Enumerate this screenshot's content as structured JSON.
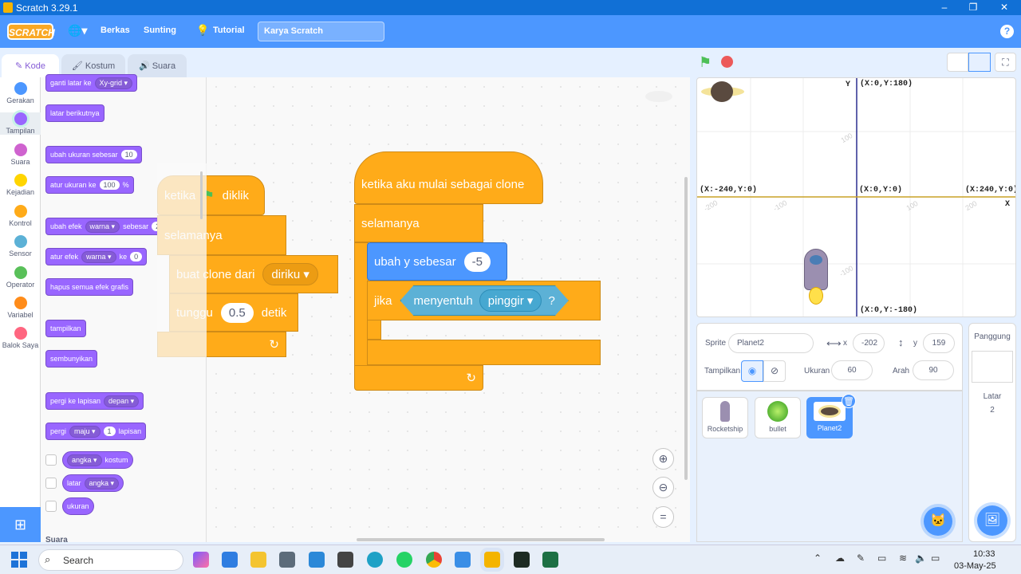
{
  "window": {
    "title": "Scratch 3.29.1",
    "minimize": "–",
    "maximize": "❐",
    "close": "✕"
  },
  "menubar": {
    "logo": "SCRATCH",
    "globe": "🌐▾",
    "file": "Berkas",
    "edit": "Sunting",
    "tutorial": "Tutorial",
    "project_title": "Karya Scratch",
    "help": "?"
  },
  "tabs": {
    "code": "Kode",
    "costume": "Kostum",
    "sound": "Suara"
  },
  "categories": [
    {
      "label": "Gerakan",
      "color": "#4c97ff"
    },
    {
      "label": "Tampilan",
      "color": "#9966ff"
    },
    {
      "label": "Suara",
      "color": "#cf63cf"
    },
    {
      "label": "Kejadian",
      "color": "#ffd500"
    },
    {
      "label": "Kontrol",
      "color": "#ffab19"
    },
    {
      "label": "Sensor",
      "color": "#5cb1d6"
    },
    {
      "label": "Operator",
      "color": "#59c059"
    },
    {
      "label": "Variabel",
      "color": "#ff8c1a"
    },
    {
      "label": "Balok Saya",
      "color": "#ff6680"
    }
  ],
  "palette": {
    "switch_backdrop": "ganti latar ke",
    "switch_backdrop_value": "Xy-grid ▾",
    "next_backdrop": "latar berikutnya",
    "change_size": "ubah ukuran sebesar",
    "change_size_value": "10",
    "set_size": "atur ukuran ke",
    "set_size_value": "100",
    "set_size_unit": "%",
    "change_effect": "ubah efek",
    "change_effect_dd": "warna ▾",
    "change_effect_by": "sebesar",
    "change_effect_value": "25",
    "set_effect": "atur efek",
    "set_effect_dd": "warna ▾",
    "set_effect_to": "ke",
    "set_effect_value": "0",
    "clear_effects": "hapus semua efek grafis",
    "show": "tampilkan",
    "hide": "sembunyikan",
    "go_to_layer": "pergi ke lapisan",
    "go_to_layer_dd": "depan ▾",
    "go_layers": "pergi",
    "go_layers_dd": "maju ▾",
    "go_layers_value": "1",
    "go_layers_unit": "lapisan",
    "costume_rep": "angka ▾",
    "costume_rep_label": "kostum",
    "backdrop_rep": "latar",
    "backdrop_rep_dd": "angka ▾",
    "size_rep": "ukuran",
    "next_section": "Suara"
  },
  "script1": {
    "hat_when": "ketika",
    "hat_clicked": "diklik",
    "forever": "selamanya",
    "create_clone": "buat clone dari",
    "clone_target": "diriku ▾",
    "wait": "tunggu",
    "wait_value": "0.5",
    "wait_unit": "detik",
    "loop_arrow": "↻"
  },
  "script2": {
    "hat": "ketika aku mulai sebagai clone",
    "forever": "selamanya",
    "change_y": "ubah y sebesar",
    "change_y_value": "-5",
    "if": "jika",
    "touching": "menyentuh",
    "touching_target": "pinggir ▾",
    "question": "?",
    "loop_arrow": "↻"
  },
  "zoom": {
    "in": "⊕",
    "out": "⊖",
    "reset": "="
  },
  "stage": {
    "coord_top": "(X:0,Y:180)",
    "coord_left": "(X:-240,Y:0)",
    "coord_center": "(X:0,Y:0)",
    "coord_right": "(X:240,Y:0)",
    "coord_bottom": "(X:0,Y:-180)",
    "axis_y": "Y",
    "axis_x": "X",
    "ticks": [
      "100",
      "-200",
      "-100",
      "100",
      "200",
      "-100"
    ]
  },
  "sprite_info": {
    "sprite_label": "Sprite",
    "sprite_name": "Planet2",
    "x_label": "x",
    "x_value": "-202",
    "y_label": "y",
    "y_value": "159",
    "show_label": "Tampilkan",
    "size_label": "Ukuran",
    "size_value": "60",
    "direction_label": "Arah",
    "direction_value": "90"
  },
  "sprites": [
    {
      "name": "Rocketship"
    },
    {
      "name": "bullet"
    },
    {
      "name": "Planet2"
    }
  ],
  "stage_panel": {
    "title": "Panggung",
    "backdrop_label": "Latar",
    "backdrop_count": "2"
  },
  "taskbar": {
    "search": "Search",
    "time": "10:33",
    "date": "03-May-25"
  }
}
